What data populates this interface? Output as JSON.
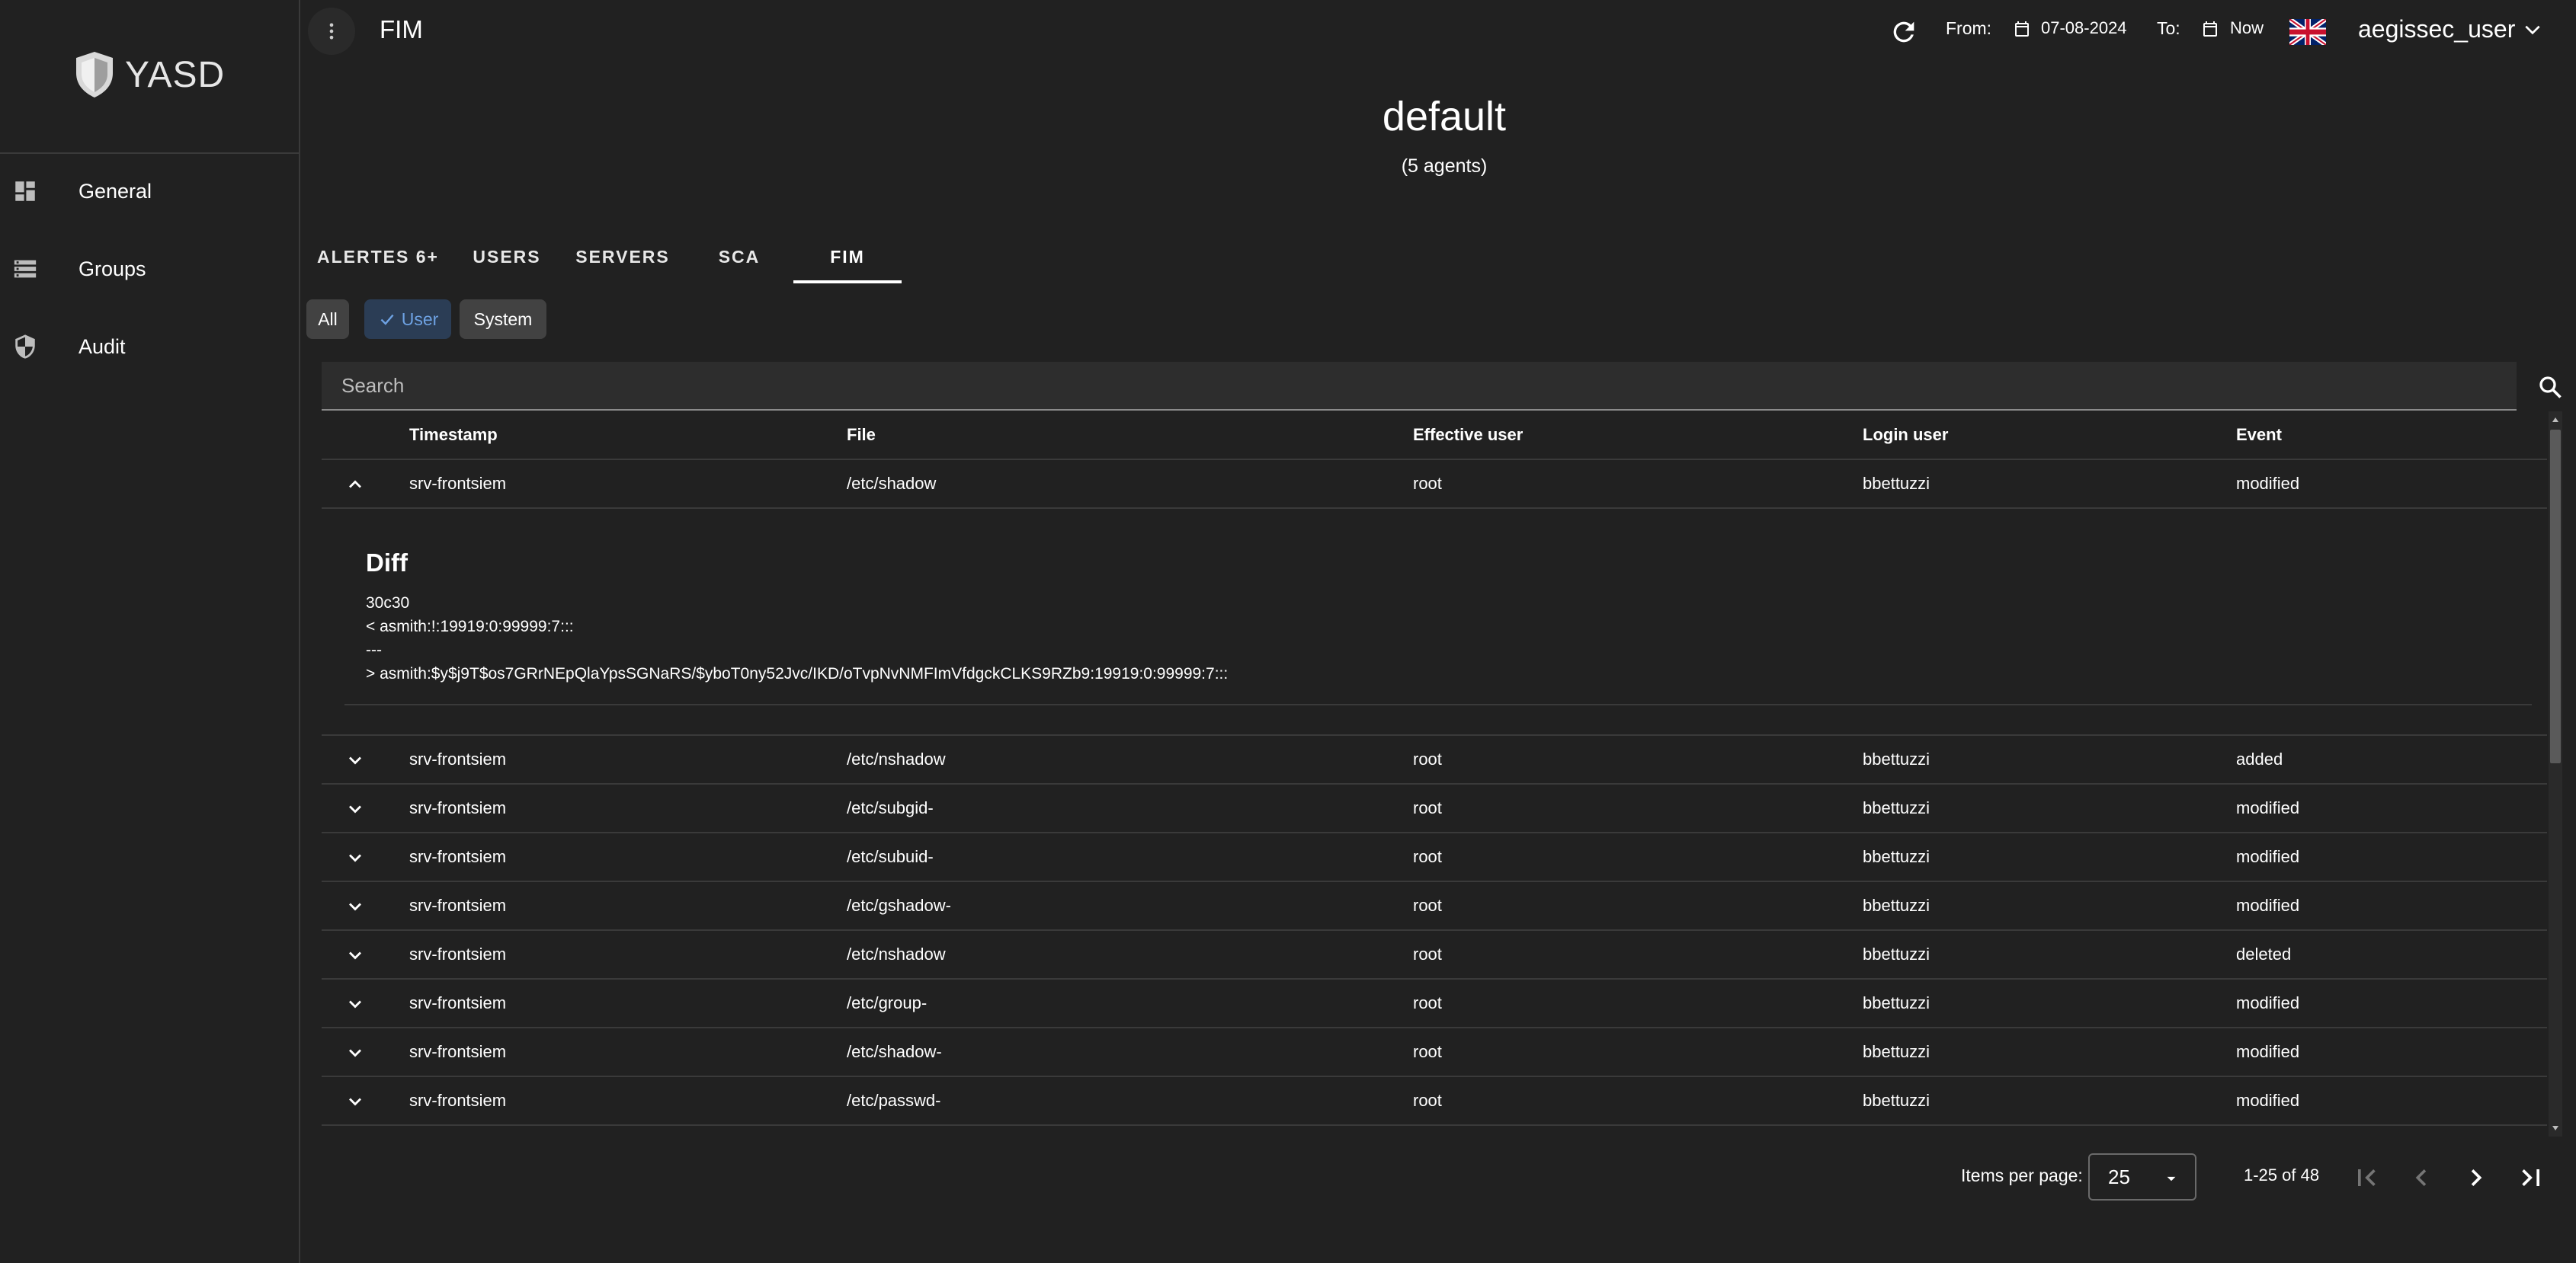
{
  "app": {
    "name": "YASD"
  },
  "sidebar": {
    "items": [
      {
        "label": "General",
        "icon": "dashboard-icon"
      },
      {
        "label": "Groups",
        "icon": "storage-icon"
      },
      {
        "label": "Audit",
        "icon": "shield-icon"
      }
    ]
  },
  "header": {
    "title": "FIM",
    "from_label": "From:",
    "from_date": "07-08-2024",
    "to_label": "To:",
    "to_date": "Now",
    "username": "aegissec_user"
  },
  "group": {
    "name": "default",
    "agents": "(5 agents)"
  },
  "tabs": [
    {
      "label": "ALERTES 6+"
    },
    {
      "label": "USERS"
    },
    {
      "label": "SERVERS"
    },
    {
      "label": "SCA"
    },
    {
      "label": "FIM",
      "active": true
    }
  ],
  "filters": {
    "all": "All",
    "user": "User",
    "system": "System",
    "selected": "User"
  },
  "search": {
    "placeholder": "Search",
    "value": ""
  },
  "table": {
    "columns": [
      "Timestamp",
      "File",
      "Effective user",
      "Login user",
      "Event"
    ],
    "rows": [
      {
        "timestamp": "srv-frontsiem",
        "file": "/etc/shadow",
        "effective_user": "root",
        "login_user": "bbettuzzi",
        "event": "modified",
        "expanded": true
      },
      {
        "timestamp": "srv-frontsiem",
        "file": "/etc/nshadow",
        "effective_user": "root",
        "login_user": "bbettuzzi",
        "event": "added"
      },
      {
        "timestamp": "srv-frontsiem",
        "file": "/etc/subgid-",
        "effective_user": "root",
        "login_user": "bbettuzzi",
        "event": "modified"
      },
      {
        "timestamp": "srv-frontsiem",
        "file": "/etc/subuid-",
        "effective_user": "root",
        "login_user": "bbettuzzi",
        "event": "modified"
      },
      {
        "timestamp": "srv-frontsiem",
        "file": "/etc/gshadow-",
        "effective_user": "root",
        "login_user": "bbettuzzi",
        "event": "modified"
      },
      {
        "timestamp": "srv-frontsiem",
        "file": "/etc/nshadow",
        "effective_user": "root",
        "login_user": "bbettuzzi",
        "event": "deleted"
      },
      {
        "timestamp": "srv-frontsiem",
        "file": "/etc/group-",
        "effective_user": "root",
        "login_user": "bbettuzzi",
        "event": "modified"
      },
      {
        "timestamp": "srv-frontsiem",
        "file": "/etc/shadow-",
        "effective_user": "root",
        "login_user": "bbettuzzi",
        "event": "modified"
      },
      {
        "timestamp": "srv-frontsiem",
        "file": "/etc/passwd-",
        "effective_user": "root",
        "login_user": "bbettuzzi",
        "event": "modified"
      }
    ],
    "diff": {
      "title": "Diff",
      "lines": [
        "30c30",
        "< asmith:!:19919:0:99999:7:::",
        "---",
        "> asmith:$y$j9T$os7GRrNEpQlaYpsSGNaRS/$yboT0ny52Jvc/IKD/oTvpNvNMFImVfdgckCLKS9RZb9:19919:0:99999:7:::"
      ]
    }
  },
  "paginator": {
    "items_per_page_label": "Items per page:",
    "page_size": "25",
    "range": "1-25 of 48"
  },
  "colors": {
    "background": "#212121",
    "accent": "#6ea2e3",
    "chip": "#424242"
  }
}
